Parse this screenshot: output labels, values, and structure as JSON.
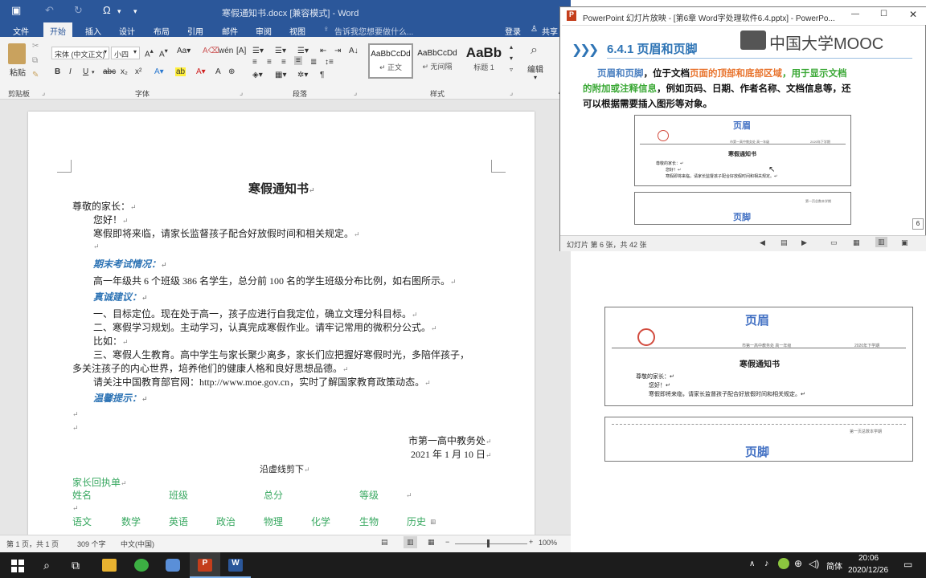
{
  "word": {
    "title": "寒假通知书.docx [兼容模式] - Word",
    "tabs": [
      "文件",
      "开始",
      "插入",
      "设计",
      "布局",
      "引用",
      "邮件",
      "审阅",
      "视图"
    ],
    "tell_me": "告诉我您想要做什么...",
    "login": "登录",
    "share": "共享",
    "font_name": "宋体 (中文正文)",
    "font_size": "小四",
    "paste": "粘贴",
    "groups": [
      "剪贴板",
      "字体",
      "段落",
      "样式"
    ],
    "styles": [
      {
        "preview": "AaBbCcDd",
        "name": "↵ 正文"
      },
      {
        "preview": "AaBbCcDd",
        "name": "↵ 无间隔"
      },
      {
        "preview": "AaBb",
        "name": "标题 1"
      }
    ],
    "edit": "编辑",
    "doc": {
      "title": "寒假通知书",
      "lines": [
        "尊敬的家长：",
        "您好！",
        "寒假即将来临，请家长监督孩子配合好放假时间和相关规定。",
        "期末考试情况：",
        "高一年级共 6 个班级 386 名学生，总分前 100 名的学生班级分布比例，如右图所示。",
        "真诚建议：",
        "一、目标定位。现在处于高一，孩子应进行自我定位，确立文理分科目标。",
        "二、寒假学习规划。主动学习，认真完成寒假作业。请牢记常用的微积分公式。",
        "比如：",
        "三、寒假人生教育。高中学生与家长聚少离多，家长们应把握好寒假时光，多陪伴孩子，",
        "多关注孩子的内心世界，培养他们的健康人格和良好思想品德。",
        "请关注中国教育部官网：http://www.moe.gov.cn，实时了解国家教育政策动态。",
        "温馨提示：",
        "市第一高中教务处",
        "2021 年 1 月 10 日",
        "沿虚线剪下",
        "家长回执单"
      ],
      "receipt_row1": [
        "姓名",
        "班级",
        "总分",
        "等级"
      ],
      "receipt_row2": [
        "语文",
        "数学",
        "英语",
        "政治",
        "物理",
        "化学",
        "生物",
        "历史"
      ]
    },
    "status": {
      "page": "第 1 页，共 1 页",
      "words": "309 个字",
      "lang": "中文(中国)",
      "zoom": "100%"
    }
  },
  "ppt": {
    "title": "PowerPoint 幻灯片放映 - [第6章 Word字处理软件6.4.pptx] - PowerPo...",
    "heading": "6.4.1  页眉和页脚",
    "logo": "中国大学MOOC",
    "body_parts": [
      {
        "text": "页眉和页脚",
        "color": "#4a7fc0"
      },
      {
        "text": "，位于文档",
        "color": "#111111"
      },
      {
        "text": "页面的顶部和底部区域",
        "color": "#e8742e"
      },
      {
        "text": "，用于显示文档",
        "color": "#3aa835"
      }
    ],
    "body_line2_parts": [
      {
        "text": "的附加或注释信息",
        "color": "#3aa835"
      },
      {
        "text": "，例如页码、日期、作者名称、文档信息等，还",
        "color": "#111111"
      }
    ],
    "body_line3": "可以根据需要插入图形等对象。",
    "thumb_header": "页眉",
    "thumb_footer": "页脚",
    "thumb_doc_title": "寒假通知书",
    "thumb_header_left": "市第一高中教务处  高一年级",
    "thumb_header_right": "2020年下学期",
    "thumb_lines": [
      "尊敬的家长：↵",
      "您好！↵",
      "寒假即将来临，请家长监督孩子配合好放假时间和相关规定。↵"
    ],
    "thumb_footer_note": "第一页总数本学期",
    "page_badge": "6",
    "status": "幻灯片 第 6 张，共 42 张"
  },
  "right": {
    "header": "页眉",
    "footer": "页脚",
    "doc_title": "寒假通知书",
    "header_left": "市第一高中教务处  高一年级",
    "header_right": "2020年下学期",
    "lines": [
      "尊敬的家长：↵",
      "您好！↵",
      "寒假即将来临，请家长监督孩子配合好放假时间和相关规定。↵"
    ],
    "footer_note": "第一页总数本学期"
  },
  "taskbar": {
    "time": "20:06",
    "date": "2020/12/26",
    "ime": "简体"
  }
}
